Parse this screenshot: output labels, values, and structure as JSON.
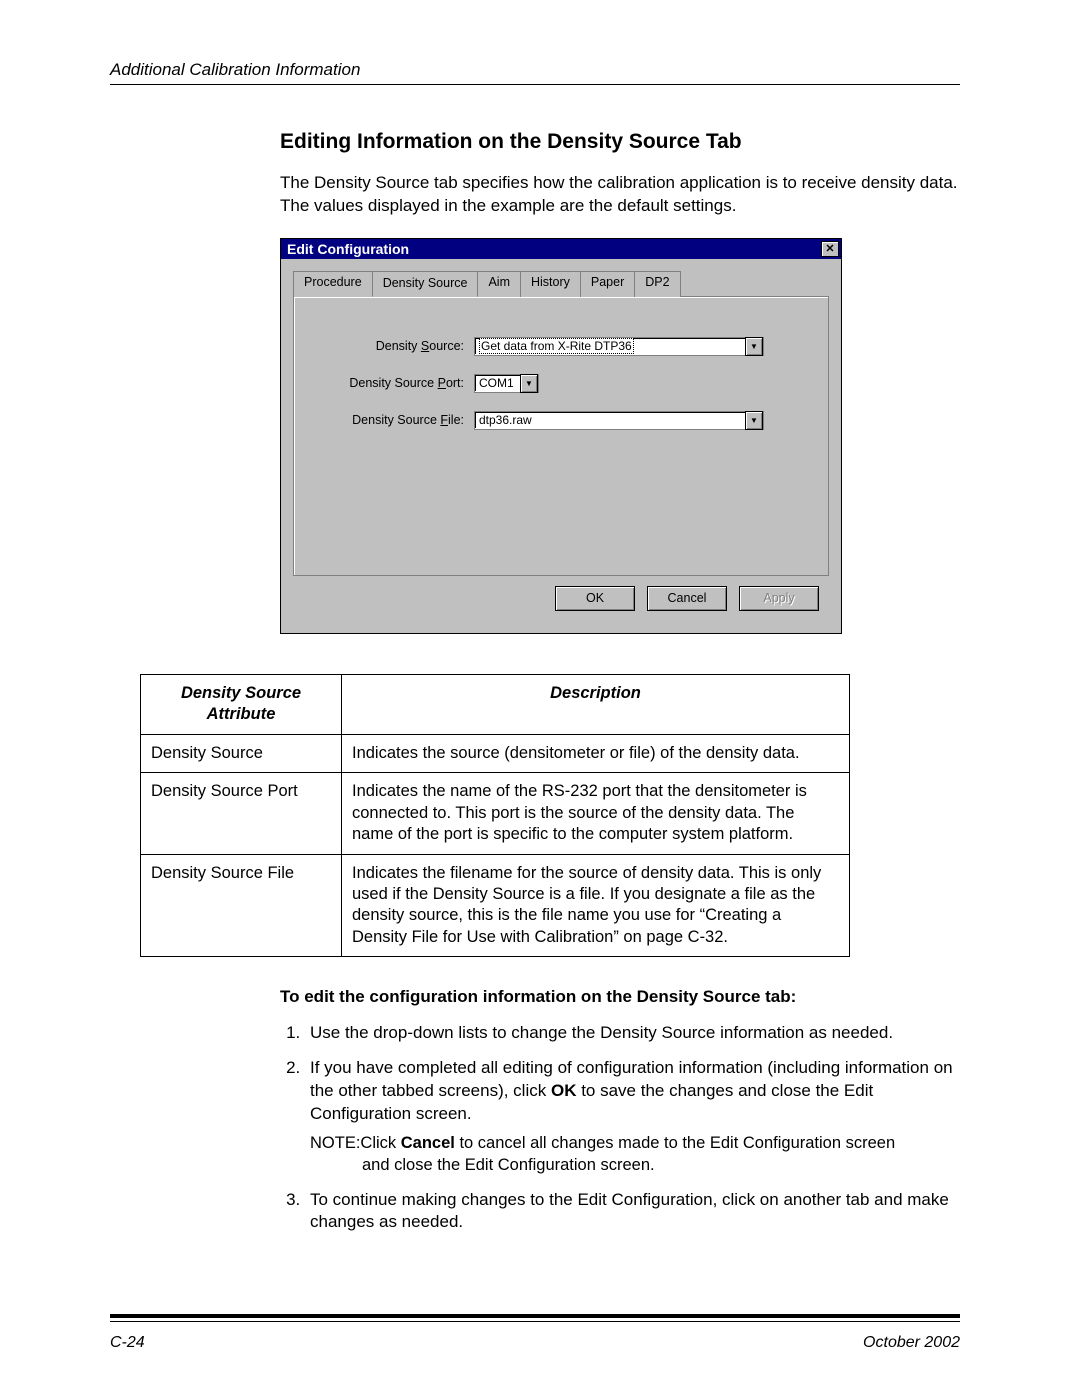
{
  "header": {
    "text": "Additional Calibration Information"
  },
  "section": {
    "title": "Editing Information on the Density Source Tab",
    "intro": "The Density Source tab specifies how the calibration application is to receive density data. The values displayed in the example are the default settings."
  },
  "dialog": {
    "title": "Edit Configuration",
    "close_glyph": "✕",
    "tabs": [
      "Procedure",
      "Density Source",
      "Aim",
      "History",
      "Paper",
      "DP2"
    ],
    "active_tab_index": 1,
    "fields": {
      "density_source": {
        "label_pre": "Density ",
        "label_u": "S",
        "label_post": "ource:",
        "value": "Get data from X-Rite DTP36"
      },
      "density_source_port": {
        "label_pre": "Density Source ",
        "label_u": "P",
        "label_post": "ort:",
        "value": "COM1"
      },
      "density_source_file": {
        "label_pre": "Density Source ",
        "label_u": "F",
        "label_post": "ile:",
        "value": "dtp36.raw"
      }
    },
    "buttons": {
      "ok": "OK",
      "cancel": "Cancel",
      "apply": "Apply"
    }
  },
  "table": {
    "headers": [
      "Density Source Attribute",
      "Description"
    ],
    "rows": [
      {
        "attr": "Density Source",
        "desc": "Indicates the source (densitometer or file) of the density data."
      },
      {
        "attr": "Density Source Port",
        "desc": "Indicates the name of the RS-232 port that the densitometer is connected to. This port is the source of the density data. The name of the port is specific to the computer system platform."
      },
      {
        "attr": "Density Source File",
        "desc": "Indicates the filename for the source of density data. This is only used if the Density Source is a file. If you designate a file as the density source, this is the file name you use for “Creating a Density File for Use with Calibration” on page C-32."
      }
    ]
  },
  "steps": {
    "title": "To edit the configuration information on the Density Source tab:",
    "items": [
      "Use the drop-down lists to change the Density Source information as needed.",
      "If you have completed all editing of configuration information (including information on the other tabbed screens), click OK to save the changes and close the Edit Configuration screen.",
      "To continue making changes to the Edit Configuration, click on another tab and make changes as needed."
    ],
    "note_label": "NOTE:",
    "note_text_1": "Click ",
    "note_bold": "Cancel",
    "note_text_2": " to cancel all changes made to the Edit Configuration screen",
    "note_text_3": "and close the Edit Configuration screen.",
    "step2_bold": "OK"
  },
  "footer": {
    "left": "C-24",
    "right": "October 2002"
  }
}
